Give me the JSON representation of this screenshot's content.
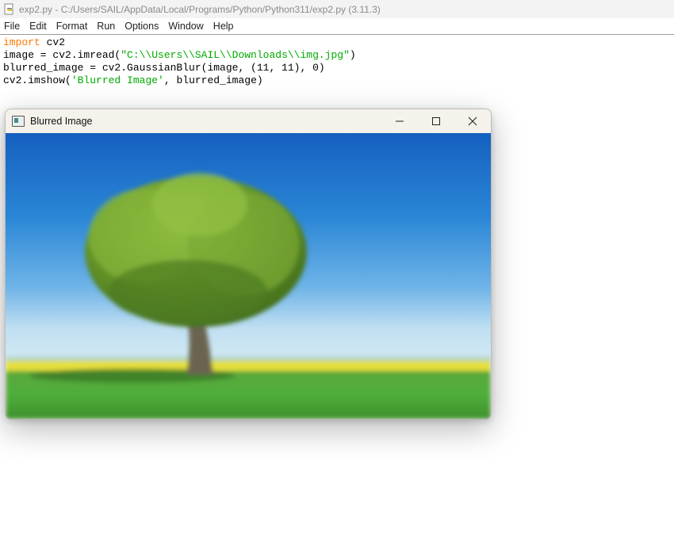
{
  "idle": {
    "title": "exp2.py - C:/Users/SAIL/AppData/Local/Programs/Python/Python311/exp2.py (3.11.3)",
    "menu": [
      "File",
      "Edit",
      "Format",
      "Run",
      "Options",
      "Window",
      "Help"
    ],
    "code": {
      "line1_kw": "import",
      "line1_rest": " cv2",
      "line2_pre": "image = cv2.imread(",
      "line2_str": "\"C:\\\\Users\\\\SAIL\\\\Downloads\\\\img.jpg\"",
      "line2_post": ")",
      "line3": "blurred_image = cv2.GaussianBlur(image, (11, 11), 0)",
      "line4_pre": "cv2.imshow(",
      "line4_str": "'Blurred Image'",
      "line4_post": ", blurred_image)"
    }
  },
  "cv_window": {
    "title": "Blurred Image",
    "icons": [
      "window-app-icon",
      "minimize-icon",
      "maximize-icon",
      "close-icon"
    ],
    "image_description_colors": {
      "sky_top": "#1565c0",
      "sky_bottom": "#bfe0f5",
      "field": "#4caf50",
      "rapeseed": "#e8e03a",
      "tree": "#6b9a2a"
    }
  },
  "colors": {
    "keyword": "#ff7700",
    "string": "#00aa00"
  }
}
